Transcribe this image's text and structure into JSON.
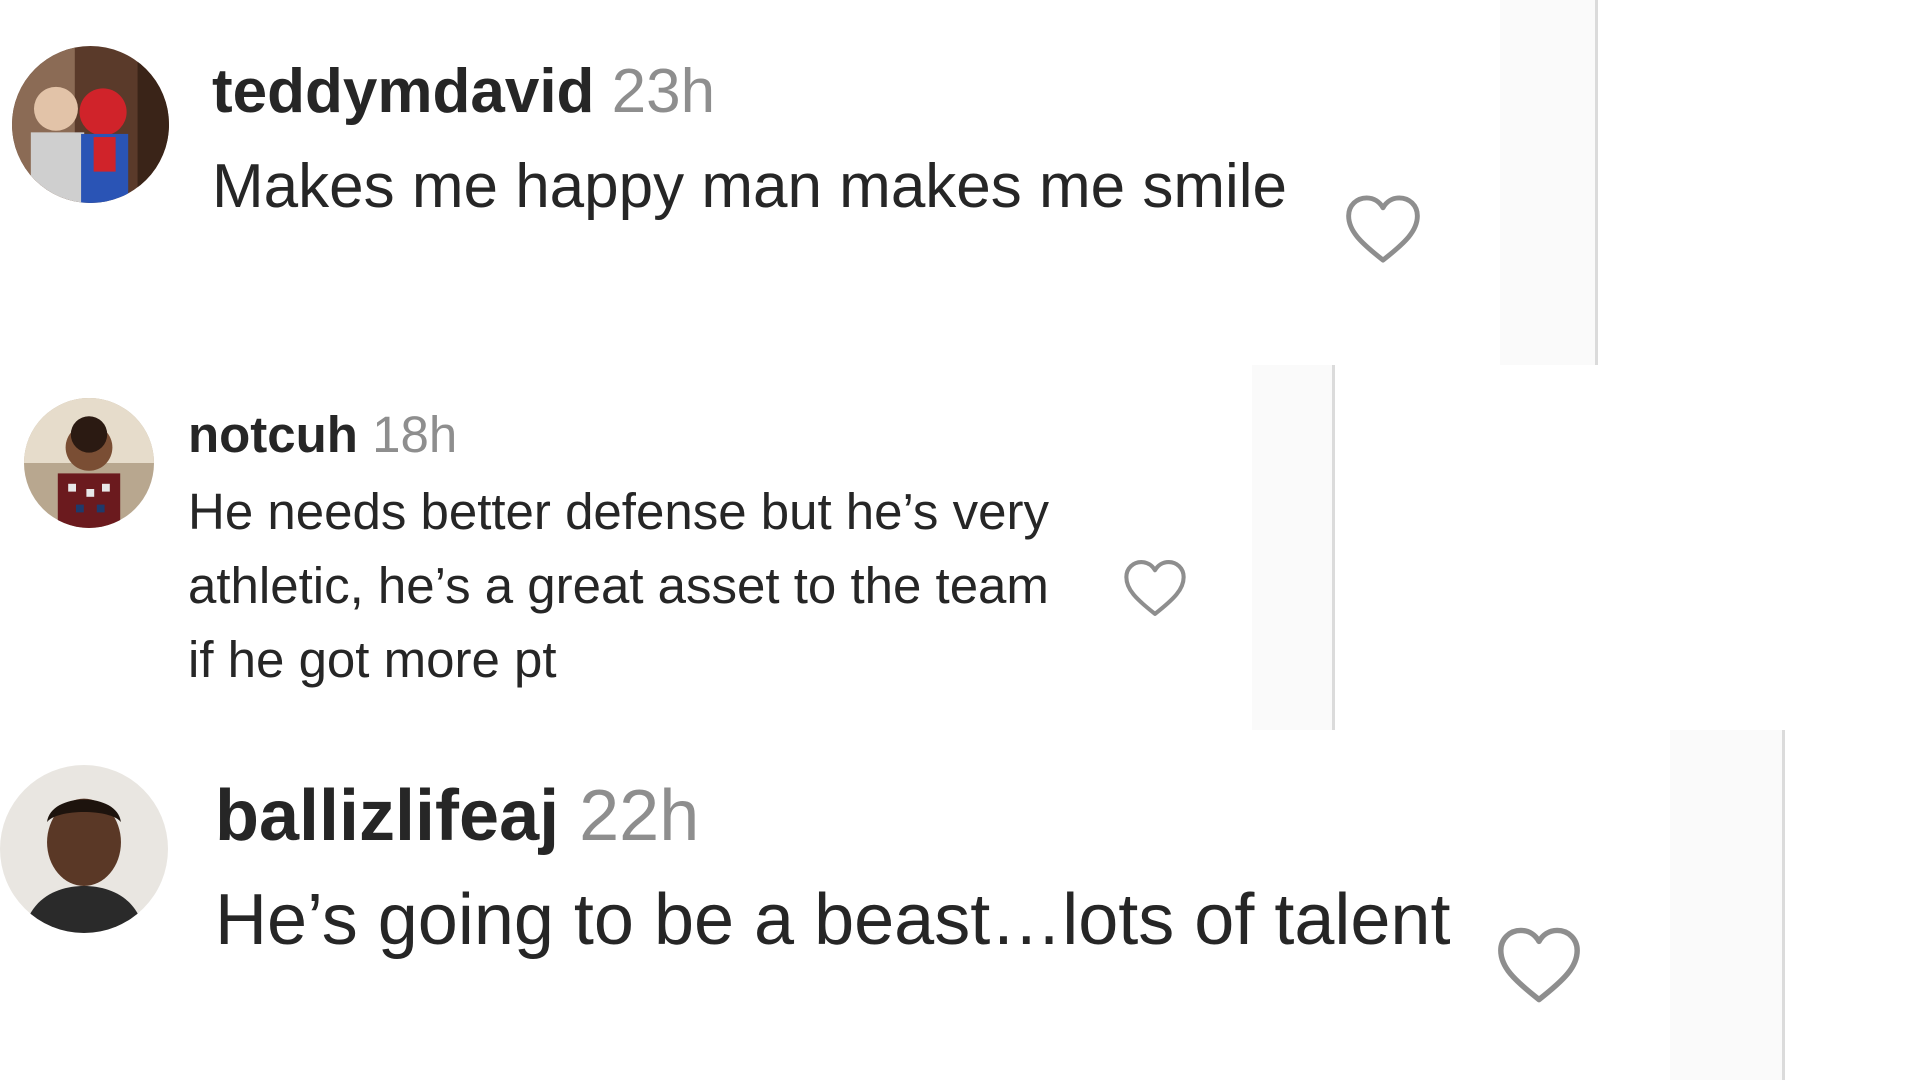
{
  "comments": [
    {
      "username": "teddymdavid",
      "time": "23h",
      "text": "Makes me happy man makes me smile",
      "avatar": "avatar-person-with-spiderman",
      "like_icon": "heart-outline-icon"
    },
    {
      "username": "notcuh",
      "time": "18h",
      "text": "He needs better defense but he’s very athletic, he’s a great asset to the team if he got more pt",
      "avatar": "avatar-child-in-sweater",
      "like_icon": "heart-outline-icon"
    },
    {
      "username": "ballizlifeaj",
      "time": "22h",
      "text": "He’s going to be a beast…lots of talent",
      "avatar": "avatar-young-man-portrait",
      "like_icon": "heart-outline-icon"
    }
  ],
  "colors": {
    "text": "#262626",
    "secondary_text": "#8e8e8e",
    "divider": "#dbdbdb",
    "panel": "#fafafa"
  }
}
